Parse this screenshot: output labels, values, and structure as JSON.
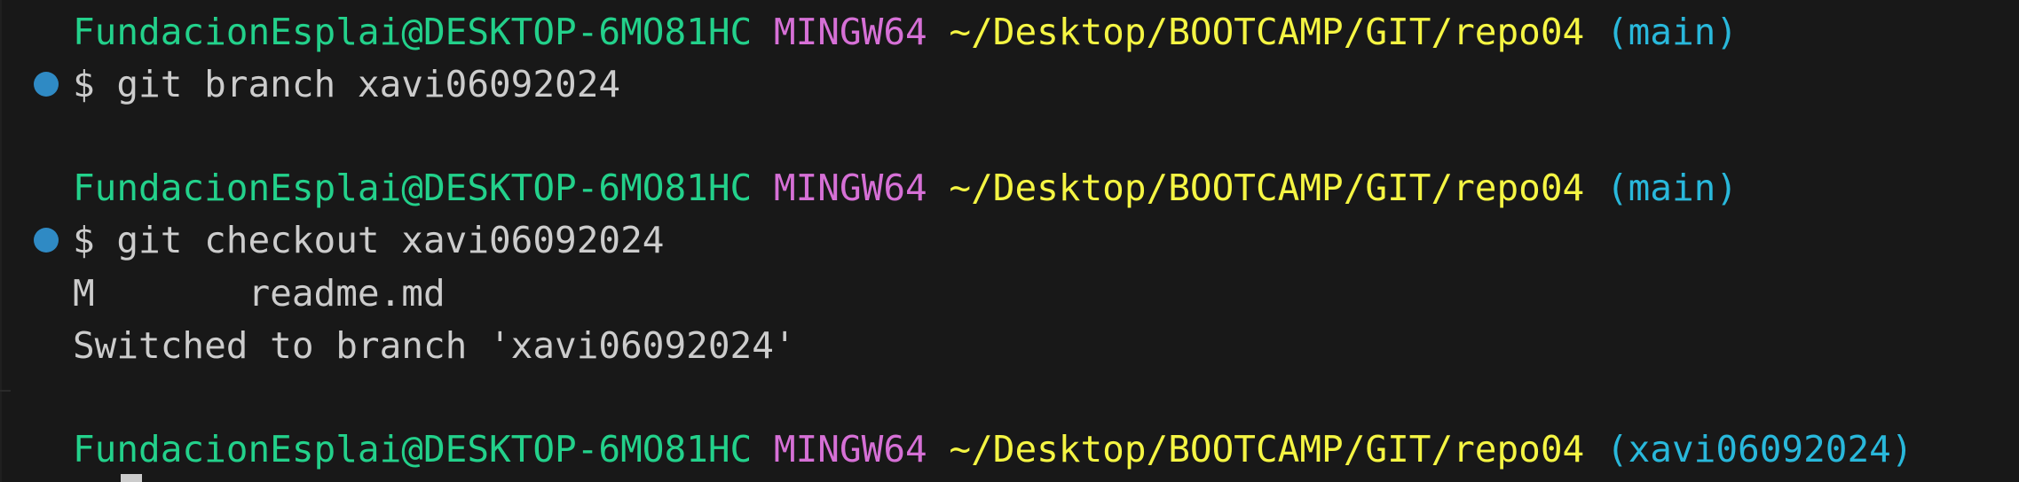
{
  "prompt": {
    "user": "FundacionEsplai@DESKTOP-6MO81HC",
    "system": "MINGW64",
    "path": "~/Desktop/BOOTCAMP/GIT/repo04",
    "branch_main": "(main)",
    "branch_new": "(xavi06092024)"
  },
  "commands": [
    "$ git branch xavi06092024",
    "$ git checkout xavi06092024"
  ],
  "output": {
    "modified_flag": "M",
    "modified_file": "readme.md",
    "switched_message": "Switched to branch 'xavi06092024'"
  },
  "colors": {
    "background": "#181818",
    "user": "#23d18b",
    "system": "#d670d6",
    "path": "#f5f543",
    "branch": "#29b8db",
    "text": "#cccccc",
    "decoration_dot": "#2f8ac4"
  }
}
